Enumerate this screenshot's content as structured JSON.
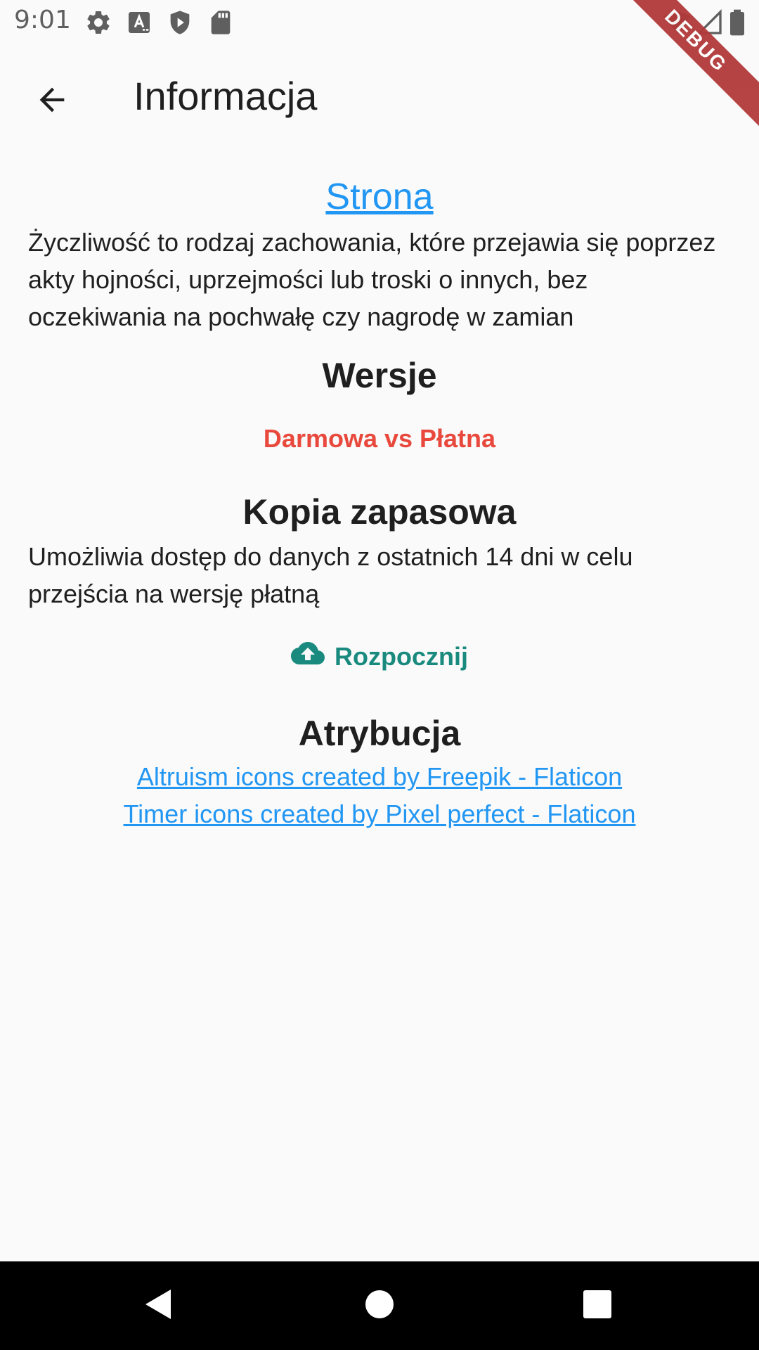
{
  "status_bar": {
    "time": "9:01",
    "icons": [
      "gear-icon",
      "keyboard-a-icon",
      "shield-play-icon",
      "sd-card-icon",
      "wifi-icon",
      "signal-icon",
      "battery-icon"
    ]
  },
  "debug_banner": {
    "label": "DEBUG",
    "color": "#b23a3a"
  },
  "app_bar": {
    "title": "Informacja",
    "back_icon": "arrow-back-icon"
  },
  "main": {
    "site_link": "Strona",
    "description": "Życzliwość to rodzaj zachowania, które przejawia się poprzez akty hojności, uprzejmości lub troski o innych, bez oczekiwania na pochwałę czy nagrodę w zamian",
    "versions_heading": "Wersje",
    "versions_link": "Darmowa vs Płatna",
    "backup_heading": "Kopia zapasowa",
    "backup_description": "Umożliwia dostęp do danych z ostatnich 14 dni w celu przejścia na wersję płatną",
    "backup_button": "Rozpocznij",
    "backup_button_icon": "cloud-upload-icon",
    "attribution_heading": "Atrybucja",
    "attribution_links": [
      "Altruism icons created by Freepik - Flaticon",
      "Timer icons created by Pixel perfect - Flaticon"
    ]
  },
  "colors": {
    "link": "#2196f3",
    "versions": "#e8493c",
    "backup_button": "#1a8a7f",
    "background": "#fafafa"
  },
  "nav_bar": {
    "buttons": [
      "back-triangle-icon",
      "home-circle-icon",
      "recents-square-icon"
    ]
  }
}
